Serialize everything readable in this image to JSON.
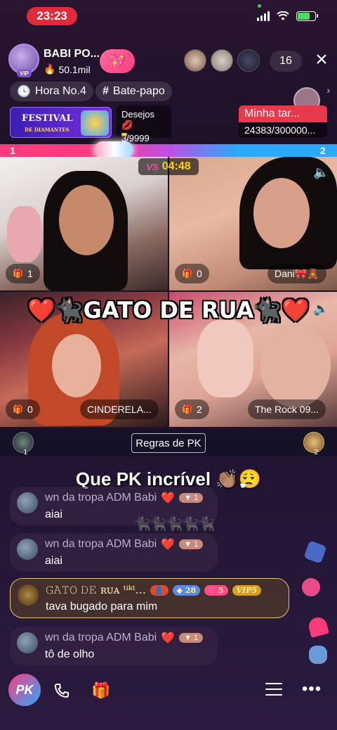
{
  "status_bar": {
    "time": "23:23"
  },
  "host": {
    "name": "BABI PO...",
    "likes": "50.1mil",
    "viewer_count": "16"
  },
  "pills": {
    "hour": "Hora No.4",
    "chat": "Bate-papo"
  },
  "festival": {
    "title": "FESTIVAL",
    "subtitle": "DE DIAMANTES"
  },
  "desejos": {
    "label": "Desejos",
    "value": "3/9999"
  },
  "mission": {
    "title": "Minha tar...",
    "value": "24383/300000..."
  },
  "pk": {
    "left_score": "1",
    "right_score": "2",
    "vs": "VS",
    "timer": "04:48",
    "team_title": "❤️🐈‍⬛GATO DE RUA🐈‍⬛❤️",
    "rules_label": "Regras de PK",
    "left_rank": "1",
    "right_rank": "2"
  },
  "tiles": [
    {
      "gifts": "1",
      "name": ""
    },
    {
      "gifts": "0",
      "name": "Dani🎀🧸"
    },
    {
      "gifts": "0",
      "name": "CINDERELA..."
    },
    {
      "gifts": "2",
      "name": "The Rock 09..."
    }
  ],
  "chat": {
    "highlight": "Que PK incrível 👏🏽😮‍💨",
    "cats": "🐈‍⬛🐈‍⬛🐈‍⬛🐈‍⬛🐈‍⬛",
    "messages": [
      {
        "name": "wn da tropa ADM Babi",
        "level": "1",
        "text": "aiai"
      },
      {
        "name": "wn da tropa ADM Babi",
        "level": "1",
        "text": "aiai"
      },
      {
        "name": "𝙶𝙰𝚃𝙾 𝙳𝙴 ʀᴜᴀ ᵗⁱᵏᵗ...",
        "badge_a": "28",
        "badge_b": "5",
        "vip": "VIP5",
        "text": "tava bugado para mim"
      },
      {
        "name": "wn da tropa ADM Babi",
        "level": "1",
        "text": "tô de olho"
      }
    ]
  },
  "bottom": {
    "pk_label": "PK"
  },
  "colors": {
    "accent_pink": "#ff3b7e",
    "accent_blue": "#2ba8ff",
    "timer_yellow": "#ffd400"
  }
}
